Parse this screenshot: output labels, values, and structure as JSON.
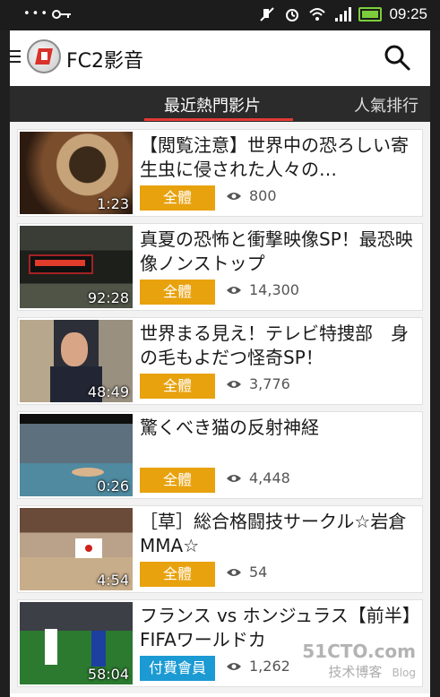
{
  "status_bar": {
    "dots": "•••",
    "time": "09:25",
    "icons": [
      "key-icon",
      "mute-icon",
      "alarm-icon",
      "wifi-icon",
      "signal-icon",
      "battery-icon"
    ]
  },
  "header": {
    "app_name": "FC2影音",
    "logo": "fc2-logo",
    "menu_icon": "menu-icon",
    "search_icon": "search-icon"
  },
  "tabs": [
    {
      "label": "最近熱門影片",
      "active": true
    },
    {
      "label": "人氣排行",
      "active": false
    }
  ],
  "videos": [
    {
      "title": "【閲覧注意】世界中の恐ろしい寄生虫に侵された人々の…",
      "duration": "1:23",
      "badge": "全體",
      "badge_color": "#e8a20e",
      "views": "800"
    },
    {
      "title": "真夏の恐怖と衝撃映像SP！最恐映像ノンストップ",
      "duration": "92:28",
      "badge": "全體",
      "badge_color": "#e8a20e",
      "views": "14,300"
    },
    {
      "title": "世界まる見え！テレビ特捜部　身の毛もよだつ怪奇SP！",
      "duration": "48:49",
      "badge": "全體",
      "badge_color": "#e8a20e",
      "views": "3,776"
    },
    {
      "title": "驚くべき猫の反射神経",
      "duration": "0:26",
      "badge": "全體",
      "badge_color": "#e8a20e",
      "views": "4,448"
    },
    {
      "title": "［草］総合格闘技サークル☆岩倉MMA☆",
      "duration": "4:54",
      "badge": "全體",
      "badge_color": "#e8a20e",
      "views": "54"
    },
    {
      "title": "フランス vs ホンジュラス【前半】FIFAワールドカ",
      "duration": "58:04",
      "badge": "付費會員",
      "badge_color": "#1b9ad3",
      "views": "1,262"
    }
  ],
  "watermark": {
    "logo": "51CTO.com",
    "sub": "技术博客",
    "blog": "Blog"
  }
}
